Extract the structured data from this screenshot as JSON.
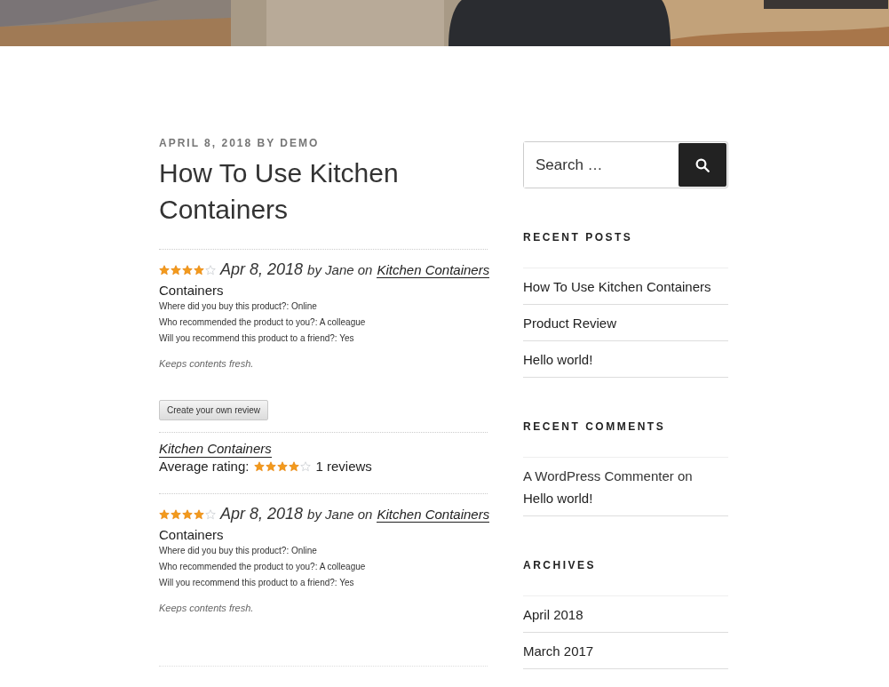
{
  "post": {
    "meta": "APRIL 8, 2018 BY DEMO",
    "title": "How To Use Kitchen Containers",
    "entries": [
      {
        "kind": "review",
        "stars": 4,
        "date": "Apr 8, 2018",
        "byline": "by Jane on",
        "product": "Kitchen Containers",
        "heading": "Containers",
        "fields": [
          "Where did you buy this product?: Online",
          "Who recommended the product to you?: A colleague",
          "Will you recommend this product to a friend?: Yes"
        ],
        "comment": "Keeps contents fresh."
      },
      {
        "kind": "button",
        "label": "Create your own review"
      },
      {
        "kind": "summary",
        "product": "Kitchen Containers",
        "label": "Average rating:",
        "stars": 4,
        "count": "1 reviews"
      },
      {
        "kind": "review",
        "stars": 4,
        "date": "Apr 8, 2018",
        "byline": "by Jane on",
        "product": "Kitchen Containers",
        "heading": "Containers",
        "fields": [
          "Where did you buy this product?: Online",
          "Who recommended the product to you?: A colleague",
          "Will you recommend this product to a friend?: Yes"
        ],
        "comment": "Keeps contents fresh."
      }
    ]
  },
  "sidebar": {
    "search": {
      "placeholder": "Search …"
    },
    "widgets": [
      {
        "title": "RECENT POSTS",
        "items": [
          {
            "link": "How To Use Kitchen Containers"
          },
          {
            "link": "Product Review"
          },
          {
            "link": "Hello world!"
          }
        ]
      },
      {
        "title": "RECENT COMMENTS",
        "items": [
          {
            "author": "A WordPress Commenter",
            "joiner": "on",
            "link": "Hello world!"
          }
        ]
      },
      {
        "title": "ARCHIVES",
        "items": [
          {
            "link": "April 2018"
          },
          {
            "link": "March 2017"
          }
        ]
      }
    ]
  }
}
